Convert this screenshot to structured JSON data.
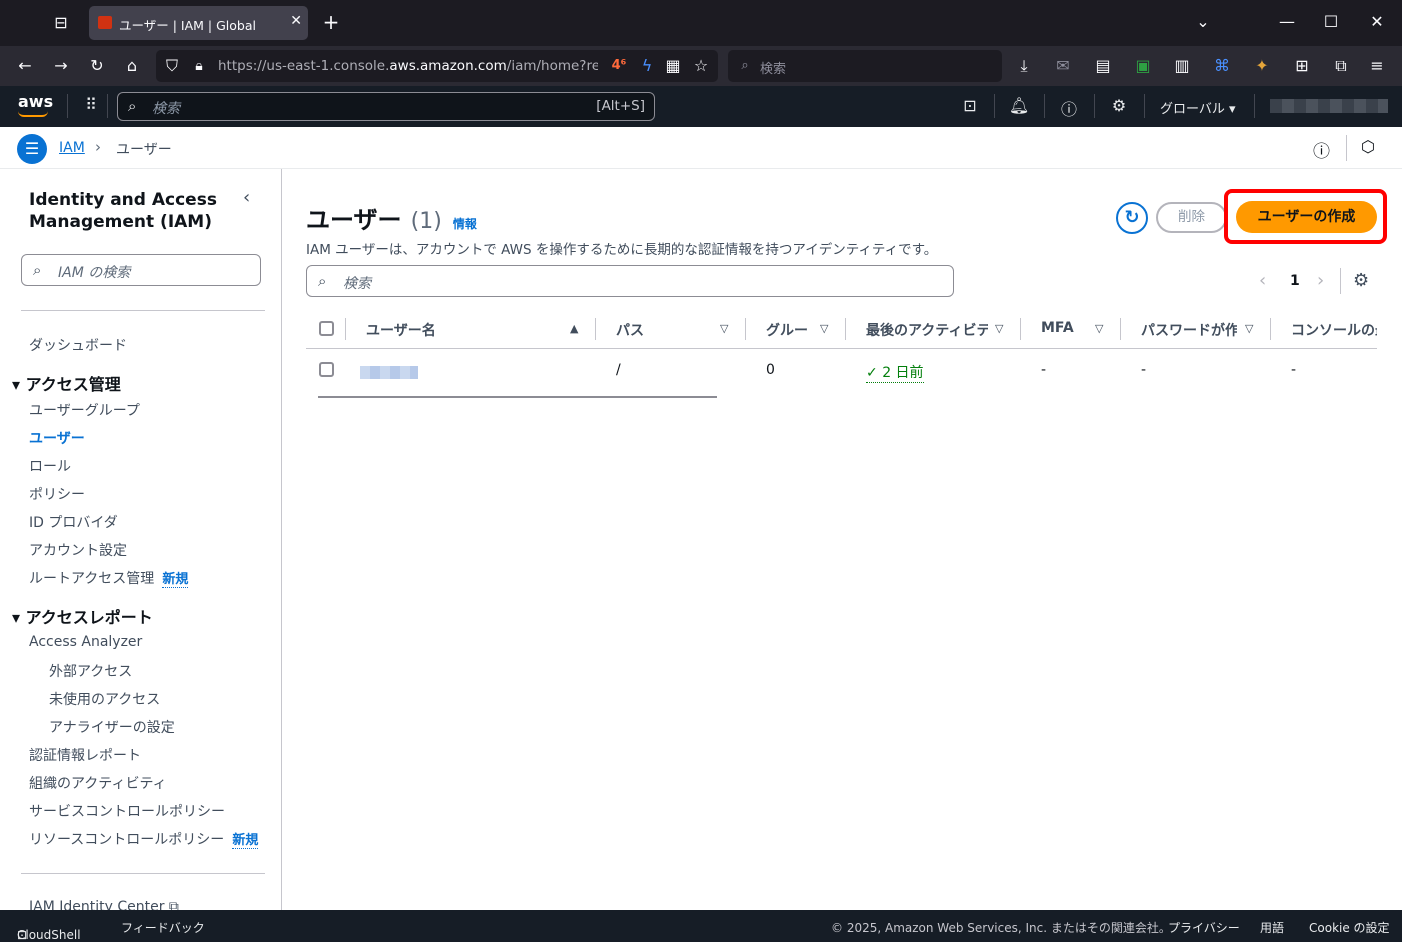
{
  "browser": {
    "tab_title": "ユーザー | IAM | Global",
    "url_prefix": "https://us-east-1.console.",
    "url_domain": "aws.amazon.com",
    "url_suffix": "/iam/home?region=",
    "search_placeholder": "検索"
  },
  "aws_header": {
    "logo": "aws",
    "search_placeholder": "検索",
    "search_shortcut": "[Alt+S]",
    "region": "グローバル"
  },
  "breadcrumb": {
    "root": "IAM",
    "current": "ユーザー"
  },
  "sidebar": {
    "title_line1": "Identity and Access",
    "title_line2": "Management (IAM)",
    "search_placeholder": "IAM の検索",
    "dashboard": "ダッシュボード",
    "section_access": "アクセス管理",
    "access_items": [
      "ユーザーグループ",
      "ユーザー",
      "ロール",
      "ポリシー",
      "ID プロバイダ",
      "アカウント設定",
      "ルートアクセス管理"
    ],
    "new_badge": "新規",
    "section_reports": "アクセスレポート",
    "report_items": [
      "Access Analyzer",
      "外部アクセス",
      "未使用のアクセス",
      "アナライザーの設定",
      "認証情報レポート",
      "組織のアクティビティ",
      "サービスコントロールポリシー",
      "リソースコントロールポリシー"
    ],
    "identity_center": "IAM Identity Center"
  },
  "main": {
    "title": "ユーザー",
    "count": "(1)",
    "info_link": "情報",
    "description": "IAM ユーザーは、アカウントで AWS を操作するために長期的な認証情報を持つアイデンティティです。",
    "delete_button": "削除",
    "create_button": "ユーザーの作成",
    "search_placeholder": "検索",
    "page_number": "1",
    "columns": [
      "ユーザー名",
      "パス",
      "グルー",
      "最後のアクティビテ",
      "MFA",
      "パスワードが作",
      "コンソールの最"
    ],
    "rows": [
      {
        "path": "/",
        "groups": "0",
        "last_activity": "2 日前",
        "mfa": "-",
        "password": "-",
        "console": "-"
      }
    ]
  },
  "footer": {
    "cloudshell": "CloudShell",
    "feedback": "フィードバック",
    "copyright": "© 2025, Amazon Web Services, Inc. またはその関連会社。",
    "privacy": "プライバシー",
    "terms": "用語",
    "cookie": "Cookie の設定"
  }
}
